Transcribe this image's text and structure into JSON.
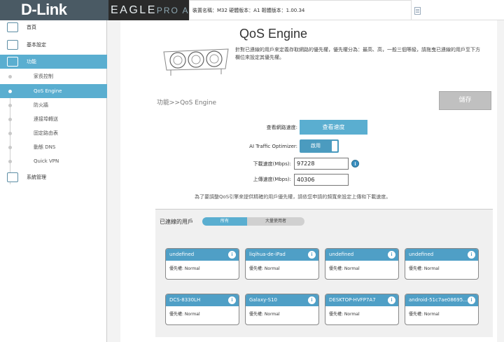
{
  "header": {
    "logo": "D-Link",
    "brand_main": "EAGLE",
    "brand_sub": "PRO AI",
    "device_info": "裝置名稱：M32   硬體版本：A1   韌體版本：1.00.34"
  },
  "sidebar": {
    "items": [
      {
        "label": "首頁",
        "icon": "home-network-icon"
      },
      {
        "label": "基本設定",
        "icon": "settings-icon"
      },
      {
        "label": "功能",
        "icon": "features-icon"
      }
    ],
    "sub_items": [
      {
        "label": "家長控制"
      },
      {
        "label": "QoS Engine"
      },
      {
        "label": "防火牆"
      },
      {
        "label": "連接埠轉送"
      },
      {
        "label": "固定路由表"
      },
      {
        "label": "動態 DNS"
      },
      {
        "label": "Quick VPN"
      }
    ],
    "bottom_item": {
      "label": "系統管理",
      "icon": "system-management-icon"
    }
  },
  "main": {
    "title": "QoS Engine",
    "description": "針對已連線的用戶來定義存取網路的優先權，優先權分為：最高、高，一般三個等級，請拖曳已連線的用戶至下方欄位來設定其優先權。",
    "breadcrumb": "功能>>QoS Engine",
    "save_label": "儲存",
    "speed_label": "查看網路速度:",
    "speed_button": "查看速度",
    "ai_label": "AI Traffic Optimizer:",
    "ai_toggle": "啟用",
    "download_label": "下載速度(Mbps):",
    "download_value": "97228",
    "upload_label": "上傳速度(Mbps):",
    "upload_value": "40306",
    "note": "為了要調整QoS引擎來提供精確的用戶優先權，請依您申請的頻寬來設定上傳和下載速度。"
  },
  "users": {
    "label": "已連線的用戶",
    "tabs": [
      "所有",
      "大量使用者"
    ],
    "info_glyph": "i",
    "cards": [
      {
        "name": "undefined",
        "priority": "優先權: Normal"
      },
      {
        "name": "liqihua-de-iPad",
        "priority": "優先權: Normal"
      },
      {
        "name": "undefined",
        "priority": "優先權: Normal"
      },
      {
        "name": "undefined",
        "priority": "優先權: Normal"
      },
      {
        "name": "DCS-8330LH",
        "priority": "優先權: Normal"
      },
      {
        "name": "Galaxy-S10",
        "priority": "優先權: Normal"
      },
      {
        "name": "DESKTOP-HVFP7A7",
        "priority": "優先權: Normal"
      },
      {
        "name": "android-51c7ae08695...",
        "priority": "優先權: Normal"
      }
    ]
  },
  "colors": {
    "accent": "#5aaed0",
    "header_bg": "#2a2a2a",
    "card_header": "#4f9fc6"
  }
}
